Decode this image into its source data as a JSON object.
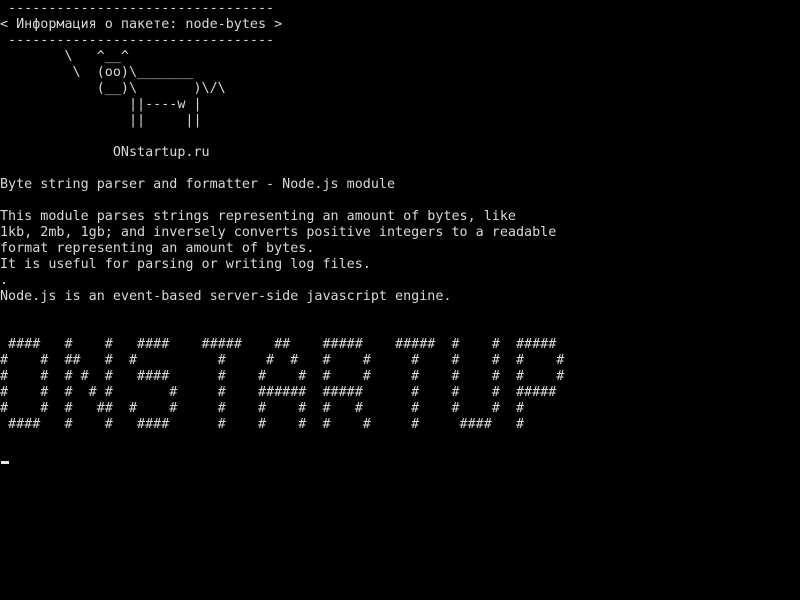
{
  "terminal": {
    "colors": {
      "background": "#000000",
      "foreground": "#d8d8d8"
    },
    "lines": [
      " ---------------------------------",
      "< Информация о пакете: node-bytes >",
      " ---------------------------------",
      "        \\   ^__^",
      "         \\  (oo)\\_______",
      "            (__)\\       )\\/\\",
      "                ||----w |",
      "                ||     ||",
      "",
      "              ONstartup.ru",
      "",
      "Byte string parser and formatter - Node.js module",
      "",
      "This module parses strings representing an amount of bytes, like",
      "1kb, 2mb, 1gb; and inversely converts positive integers to a readable",
      "format representing an amount of bytes.",
      "It is useful for parsing or writing log files.",
      ".",
      "Node.js is an event-based server-side javascript engine.",
      "",
      "",
      " ####   #    #   ####    #####    ##    #####    #####  #    #  #####",
      "#    #  ##   #  #          #     #  #   #    #     #    #    #  #    #",
      "#    #  # #  #   ####      #    #    #  #    #     #    #    #  #    #",
      "#    #  #  # #       #     #    ######  #####      #    #    #  #####",
      "#    #  #   ##  #    #     #    #    #  #   #      #    #    #  #",
      " ####   #    #   ####      #    #    #  #    #     #     ####   #"
    ]
  }
}
